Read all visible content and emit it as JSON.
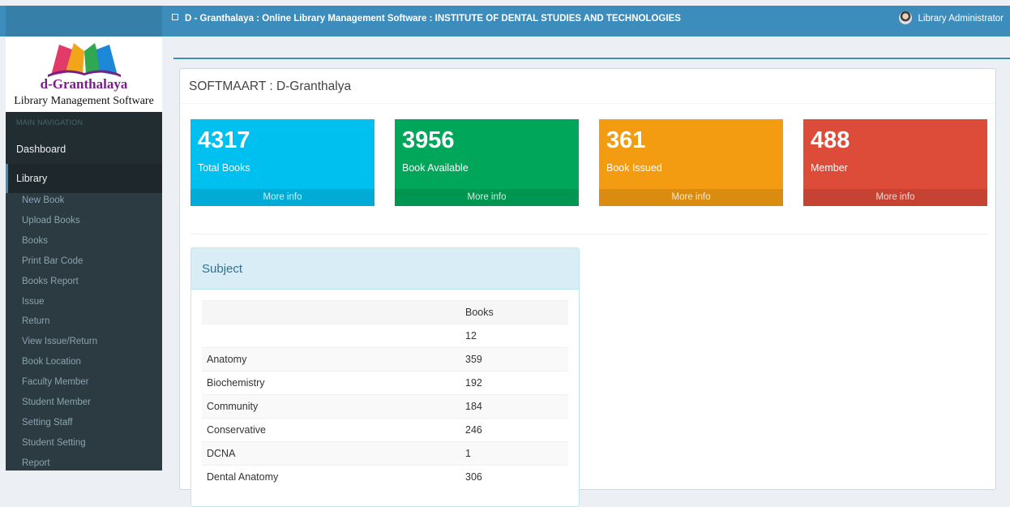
{
  "header": {
    "title": "D - Granthalaya : Online Library Management Software : INSTITUTE OF DENTAL STUDIES AND TECHNOLOGIES",
    "user": "Library Administrator"
  },
  "logo": {
    "name": "d-Granthalaya",
    "tagline": "Library Management Software"
  },
  "sidebar": {
    "header": "MAIN NAVIGATION",
    "dashboard": "Dashboard",
    "library": "Library",
    "submenu": [
      "New Book",
      "Upload Books",
      "Books",
      "Print Bar Code",
      "Books Report",
      "Issue",
      "Return",
      "View Issue/Return",
      "Book Location",
      "Faculty Member",
      "Student Member",
      "Setting Staff",
      "Student Setting",
      "Report"
    ]
  },
  "main": {
    "title": "SOFTMAART : D-Granthalya",
    "stats": [
      {
        "value": "4317",
        "label": "Total Books",
        "footer": "More info",
        "color": "#00c0ef"
      },
      {
        "value": "3956",
        "label": "Book Available",
        "footer": "More info",
        "color": "#00a65a"
      },
      {
        "value": "361",
        "label": "Book Issued",
        "footer": "More info",
        "color": "#f39c12"
      },
      {
        "value": "488",
        "label": "Member",
        "footer": "More info",
        "color": "#dd4b39"
      }
    ],
    "subject_panel": {
      "title": "Subject",
      "columns": [
        "",
        "Books"
      ],
      "rows": [
        [
          "",
          "12"
        ],
        [
          "Anatomy",
          "359"
        ],
        [
          "Biochemistry",
          "192"
        ],
        [
          "Community",
          "184"
        ],
        [
          "Conservative",
          "246"
        ],
        [
          "DCNA",
          "1"
        ],
        [
          "Dental Anatomy",
          "306"
        ]
      ]
    }
  }
}
